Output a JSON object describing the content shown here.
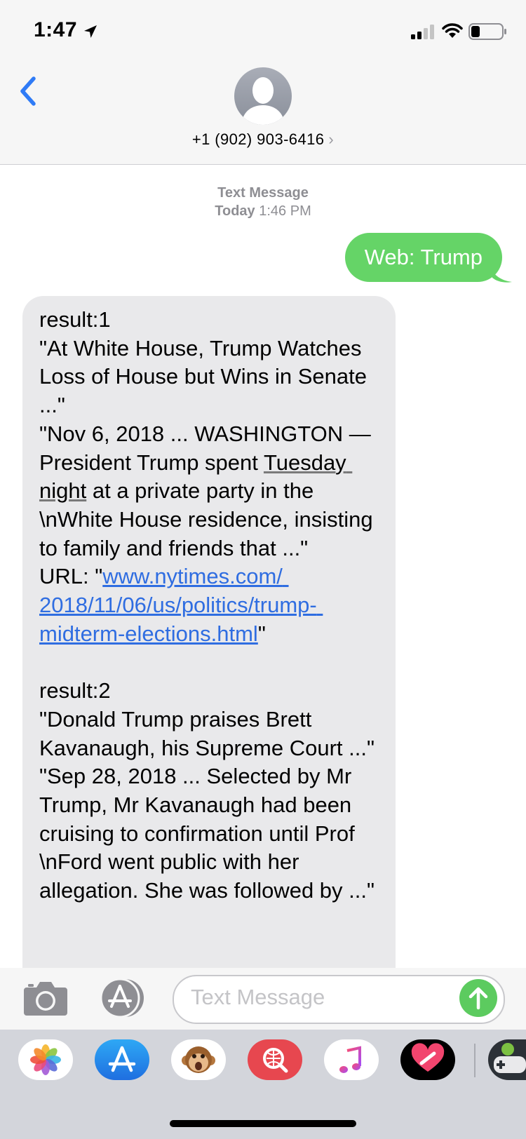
{
  "status_bar": {
    "time": "1:47"
  },
  "header": {
    "contact": "+1 (902) 903-6416",
    "chevron": "›"
  },
  "conversation": {
    "timestamp_label": "Text Message",
    "timestamp_day": "Today",
    "timestamp_time": "1:46 PM",
    "sent_message": "Web: Trump",
    "received": {
      "r1_title": "result:1\n\"At White House, Trump Watches Loss of House but Wins in Senate ...\"\n\"Nov 6, 2018 ... WASHINGTON — President Trump spent ",
      "r1_underlined": "Tuesday night",
      "r1_snippet": " at a private party in the \\nWhite House residence, insisting to family and friends that ...\"\nURL: \"",
      "r1_url": "www.nytimes.com/ 2018/11/06/us/politics/trump- midterm-elections.html",
      "r1_end": "\"\n\n",
      "r2_text": "result:2\n\"Donald Trump praises Brett Kavanaugh, his Supreme Court ...\"\n\"Sep 28, 2018 ... Selected by Mr Trump, Mr Kavanaugh had been cruising to confirmation until Prof \\nFord went public with her allegation. She was followed by ...\""
    }
  },
  "composer": {
    "placeholder": "Text Message"
  },
  "colors": {
    "sent_bubble": "#65d467",
    "received_bubble": "#e9e9eb",
    "accent_blue": "#2f6de1",
    "send_button": "#5ccb5f"
  },
  "icons": {
    "back": "chevron-left-icon",
    "camera": "camera-icon",
    "app_store": "app-store-icon",
    "send": "arrow-up-icon",
    "drawer": [
      "photos-app-icon",
      "app-store-app-icon",
      "animoji-icon",
      "web-search-icon",
      "music-icon",
      "digital-touch-icon",
      "game-app-icon"
    ]
  }
}
